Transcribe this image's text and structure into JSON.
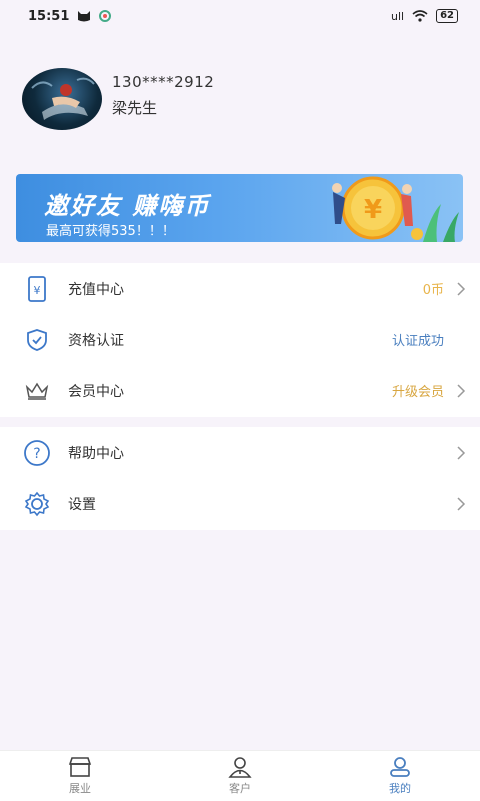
{
  "status_bar": {
    "time": "15:51",
    "network": "ull",
    "battery": "62"
  },
  "profile": {
    "phone": "130****2912",
    "name": "梁先生"
  },
  "banner": {
    "title": "邀好友  赚嗨币",
    "subtitle": "最高可获得535！！！"
  },
  "menu_group1": [
    {
      "label": "充值中心",
      "value": "0币",
      "icon": "wallet-icon"
    },
    {
      "label": "资格认证",
      "value": "认证成功",
      "icon": "shield-check-icon"
    },
    {
      "label": "会员中心",
      "value": "升级会员",
      "icon": "crown-icon"
    }
  ],
  "menu_group2": [
    {
      "label": "帮助中心",
      "icon": "help-icon"
    },
    {
      "label": "设置",
      "icon": "gear-icon"
    }
  ],
  "tabbar": [
    {
      "label": "展业",
      "icon": "store-icon",
      "active": false
    },
    {
      "label": "客户",
      "icon": "customer-icon",
      "active": false
    },
    {
      "label": "我的",
      "icon": "profile-icon",
      "active": true
    }
  ],
  "colors": {
    "accent": "#4a7fbf",
    "coin": "#e8b44a",
    "gold": "#d8a640",
    "banner": "#4a97e6"
  }
}
